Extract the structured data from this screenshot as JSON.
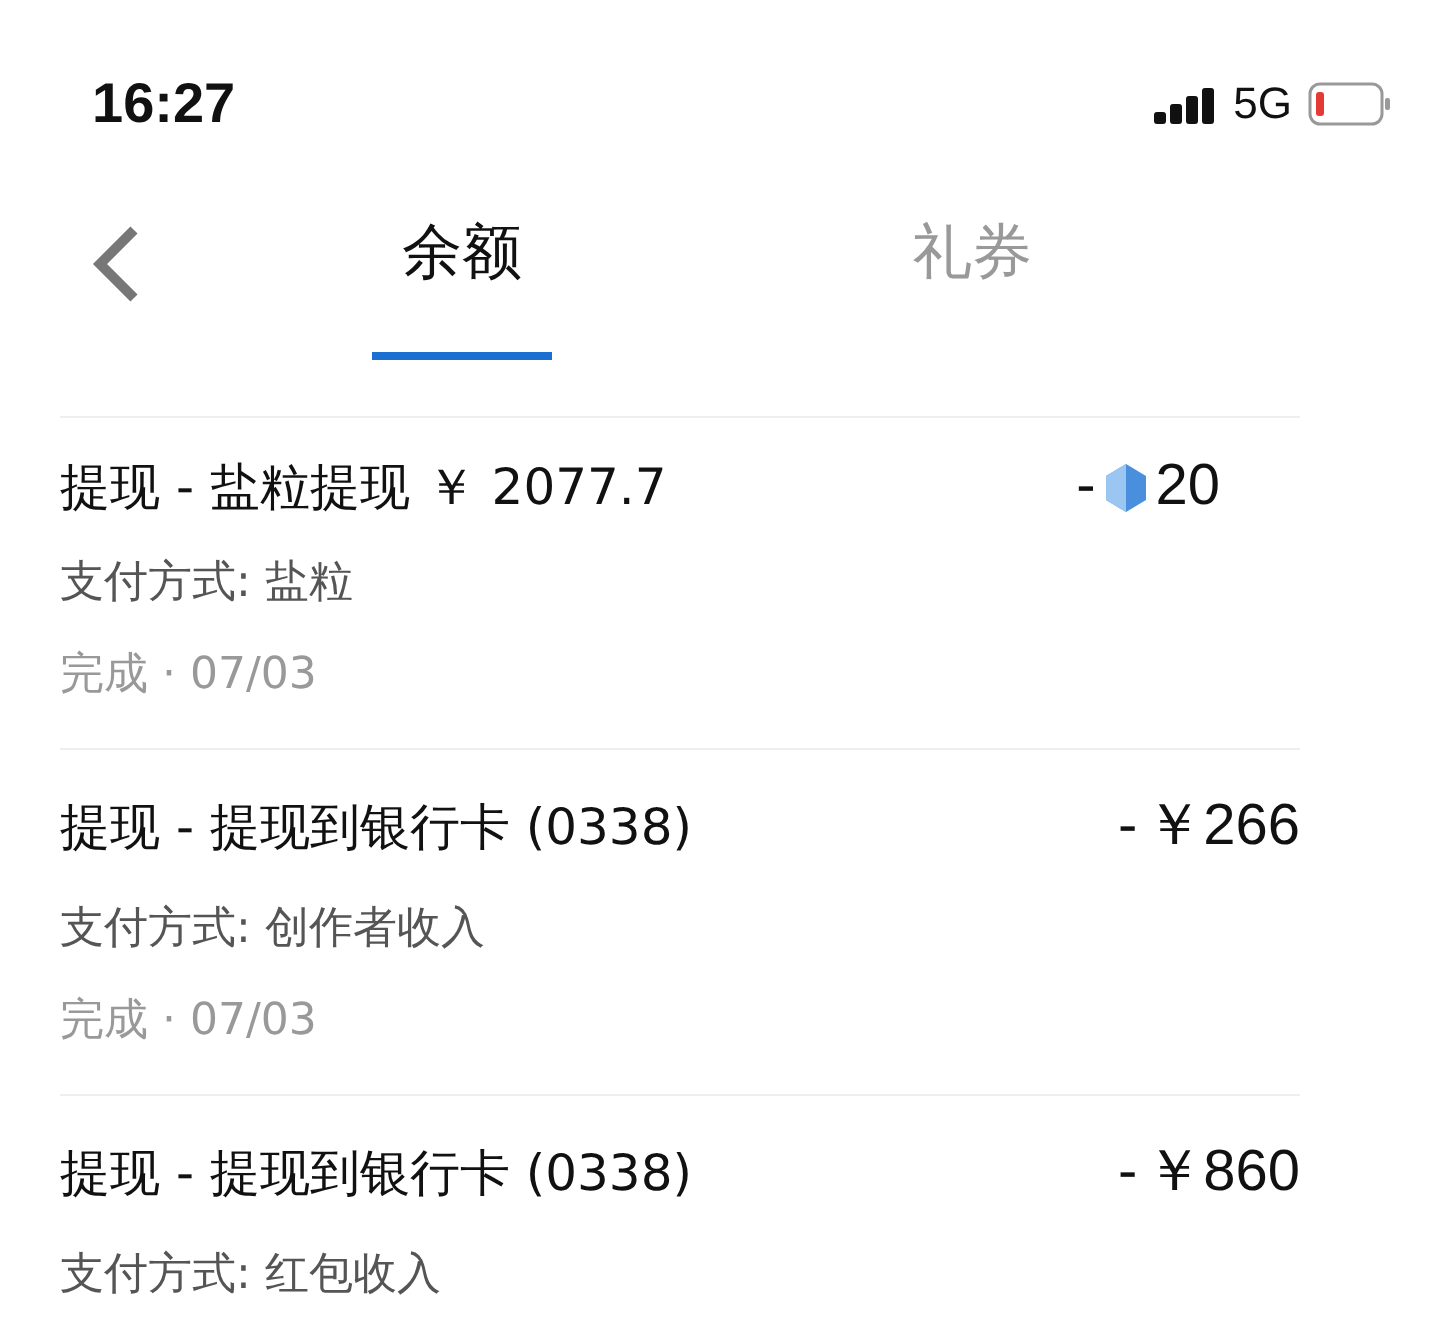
{
  "status_bar": {
    "time": "16:27",
    "network": "5G"
  },
  "tabs": [
    {
      "label": "余额",
      "selected": true
    },
    {
      "label": "礼券",
      "selected": false
    }
  ],
  "transactions": [
    {
      "title": "提现 - 盐粒提现 ￥ 2077.7",
      "payment": "支付方式: 盐粒",
      "status": "完成 · 07/03",
      "amount": {
        "kind": "coin",
        "sign": "-",
        "value": "20"
      }
    },
    {
      "title": "提现 - 提现到银行卡 (0338)",
      "payment": "支付方式: 创作者收入",
      "status": "完成 · 07/03",
      "amount": {
        "kind": "plain",
        "sign": "-",
        "value": "￥266"
      }
    },
    {
      "title": "提现 - 提现到银行卡 (0338)",
      "payment": "支付方式: 红包收入",
      "amount": {
        "kind": "plain",
        "sign": "-",
        "value": "￥860"
      }
    }
  ]
}
